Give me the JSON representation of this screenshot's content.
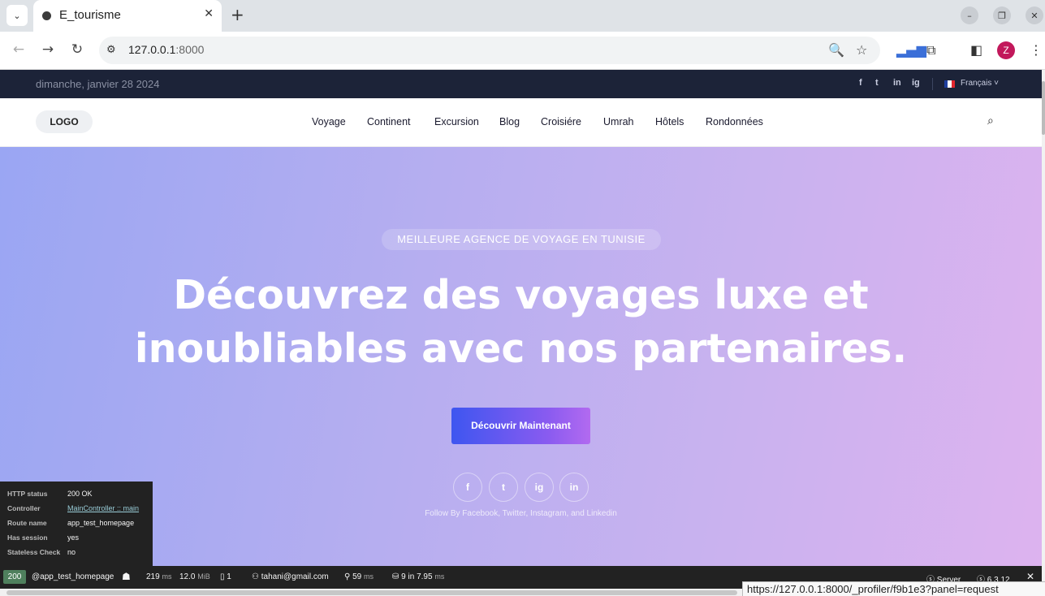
{
  "browser": {
    "tab_title": "E_tourisme",
    "url_host": "127.0.0.1",
    "url_port": ":8000",
    "profile_initial": "Z",
    "status_url": "https://127.0.0.1:8000/_profiler/f9b1e3?panel=request"
  },
  "topbar": {
    "date": "dimanche, janvier 28 2024",
    "social": [
      "f",
      "t",
      "in",
      "ig"
    ],
    "language": "Français ˅"
  },
  "header": {
    "logo": "LOGO",
    "nav": [
      "Voyage",
      "Continent",
      "Excursion",
      "Blog",
      "Croisiére",
      "Umrah",
      "Hôtels",
      "Rondonnées"
    ]
  },
  "hero": {
    "badge": "MEILLEURE AGENCE DE VOYAGE EN TUNISIE",
    "title_line1": "Découvrez des voyages luxe et",
    "title_line2": "inoubliables avec nos partenaires.",
    "cta": "Découvrir Maintenant",
    "social_icons": [
      "f",
      "t",
      "ig",
      "in"
    ],
    "follow_text": "Follow By Facebook, Twitter, Instagram, and Linkedin"
  },
  "debug_panel": {
    "rows": [
      {
        "key": "HTTP status",
        "value": "200 OK"
      },
      {
        "key": "Controller",
        "value": "MainController :: main"
      },
      {
        "key": "Route name",
        "value": "app_test_homepage"
      },
      {
        "key": "Has session",
        "value": "yes"
      },
      {
        "key": "Stateless Check",
        "value": "no"
      }
    ]
  },
  "sf_toolbar": {
    "status": "200",
    "route": "@app_test_homepage",
    "time": "219",
    "time_unit": "ms",
    "memory": "12.0",
    "memory_unit": "MiB",
    "forms": "1",
    "user": "tahani@gmail.com",
    "events": "59",
    "events_unit": "ms",
    "db": "9",
    "db_mid": "in 7.95",
    "db_unit": "ms",
    "server": "Server",
    "version": "6.3.12"
  }
}
